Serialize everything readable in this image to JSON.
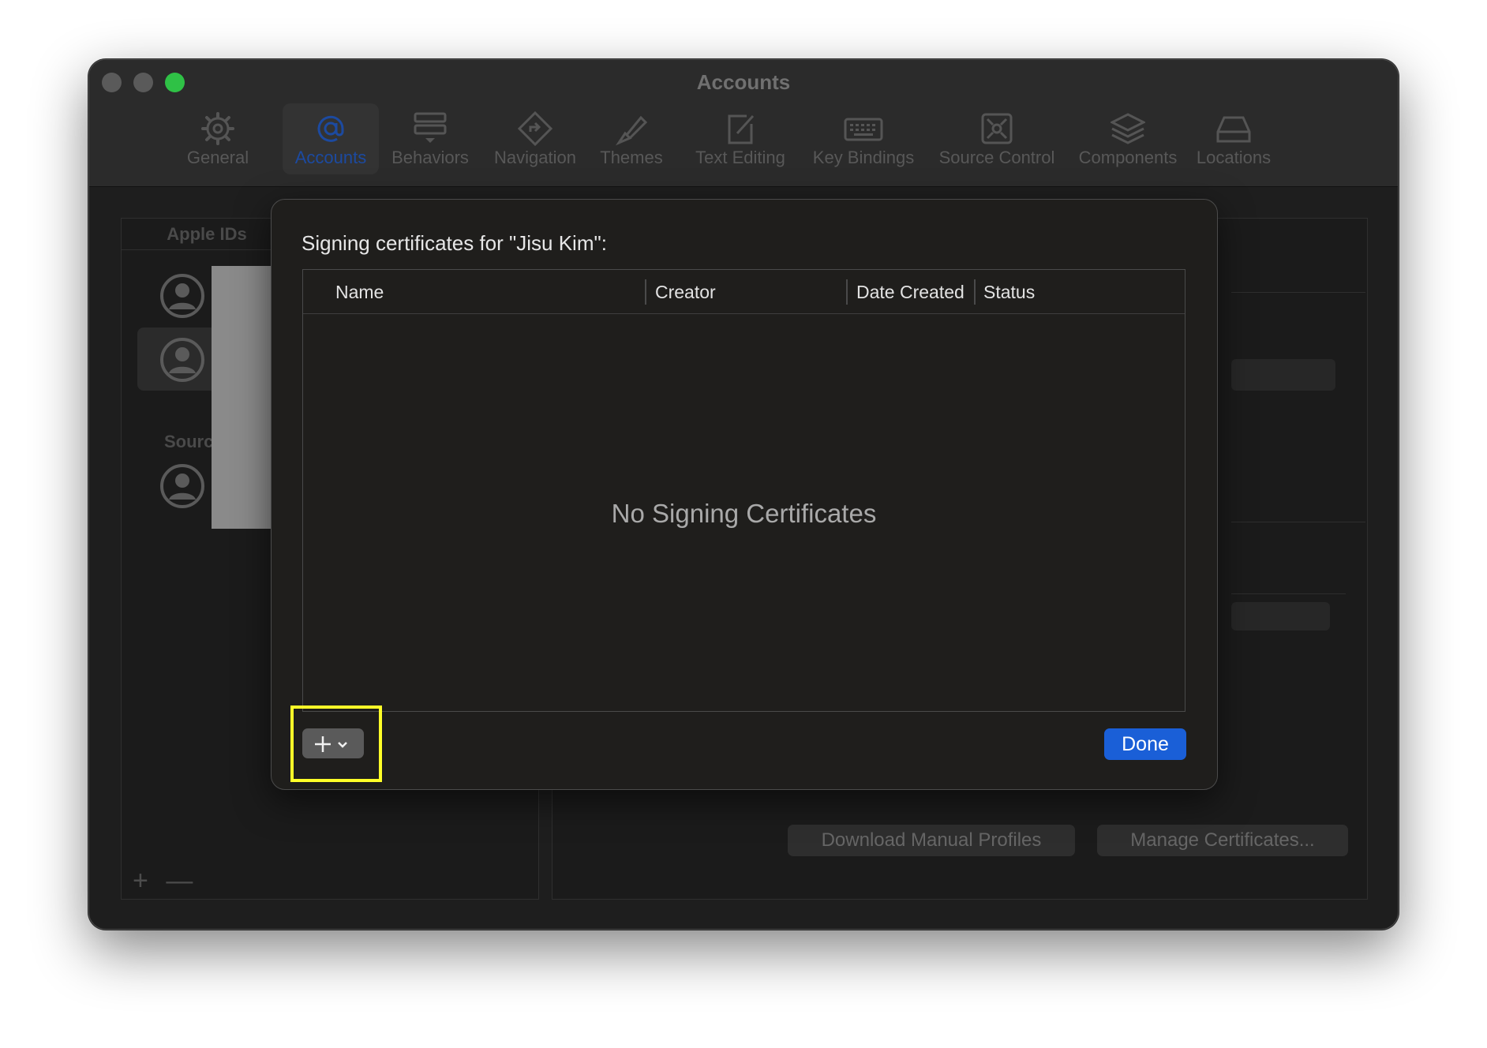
{
  "window": {
    "title": "Accounts",
    "colors": {
      "zoom": "#2fc146",
      "selected_tab": "#1c4aa0",
      "accent": "#1a5fd7",
      "highlight": "#ffff28"
    }
  },
  "toolbar": {
    "items": [
      {
        "label": "General",
        "icon": "gear-icon"
      },
      {
        "label": "Accounts",
        "icon": "at-sign-icon",
        "selected": true
      },
      {
        "label": "Behaviors",
        "icon": "behaviors-icon"
      },
      {
        "label": "Navigation",
        "icon": "navigation-diamond-icon"
      },
      {
        "label": "Themes",
        "icon": "brush-icon"
      },
      {
        "label": "Text Editing",
        "icon": "edit-icon"
      },
      {
        "label": "Key Bindings",
        "icon": "keyboard-icon"
      },
      {
        "label": "Source Control",
        "icon": "source-control-icon"
      },
      {
        "label": "Components",
        "icon": "stack-icon"
      },
      {
        "label": "Locations",
        "icon": "drive-icon"
      }
    ]
  },
  "left_panel": {
    "apple_ids_header": "Apple IDs",
    "source_header": "Sourc",
    "add_symbol": "+",
    "remove_symbol": "—"
  },
  "right_panel": {
    "download_button": "Download Manual Profiles",
    "manage_button": "Manage Certificates..."
  },
  "sheet": {
    "title": "Signing certificates for \"Jisu Kim\":",
    "columns": [
      "Name",
      "Creator",
      "Date Created",
      "Status"
    ],
    "empty_message": "No Signing Certificates",
    "done_label": "Done"
  }
}
